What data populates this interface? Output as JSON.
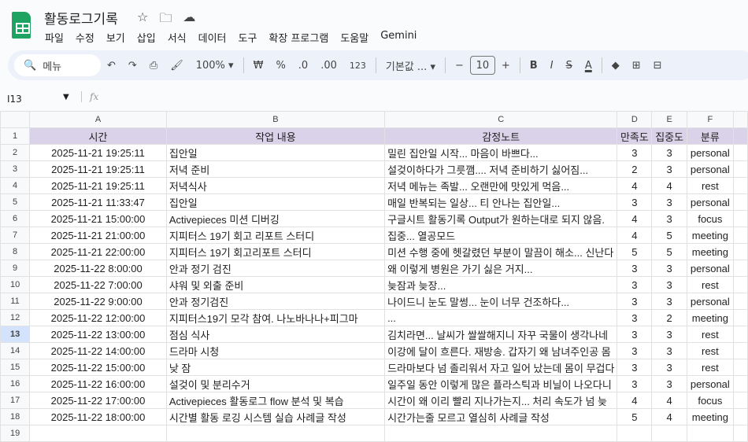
{
  "title": "활동로그기록",
  "menus": [
    "파일",
    "수정",
    "보기",
    "삽입",
    "서식",
    "데이터",
    "도구",
    "확장 프로그램",
    "도움말",
    "Gemini"
  ],
  "toolbar": {
    "search": "메뉴",
    "zoom": "100%",
    "currency": "₩",
    "percent": "%",
    "dec_less": ".0",
    "dec_more": ".00",
    "number_format": "123",
    "font": "기본값 ...",
    "font_size": "10",
    "bold": "B",
    "italic": "I",
    "strike": "S",
    "text_color": "A"
  },
  "name_box": "I13",
  "fx": "fx",
  "columns": [
    "A",
    "B",
    "C",
    "D",
    "E",
    "F"
  ],
  "header": [
    "시간",
    "작업 내용",
    "감정노트",
    "만족도",
    "집중도",
    "분류"
  ],
  "rows": [
    [
      "2025-11-21 19:25:11",
      "집안일",
      "밀린 집안일 시작... 마음이 바쁘다...",
      "3",
      "3",
      "personal"
    ],
    [
      "2025-11-21 19:25:11",
      "저녁 준비",
      "설겆이하다가 그릇깸.... 저녁 준비하기 싫어짐...",
      "2",
      "3",
      "personal"
    ],
    [
      "2025-11-21 19:25:11",
      "저녁식사",
      "저녁 메뉴는 족발... 오랜만에 맛있게 먹음...",
      "4",
      "4",
      "rest"
    ],
    [
      "2025-11-21 11:33:47",
      "집안일",
      "매일 반복되는 일상... 티 안나는 집안일...",
      "3",
      "3",
      "personal"
    ],
    [
      "2025-11-21 15:00:00",
      "Activepieces 미션 디버깅",
      "구글시트 활동기록 Output가 원하는대로 되지 않음.",
      "4",
      "3",
      "focus"
    ],
    [
      "2025-11-21 21:00:00",
      "지피터스 19기 회고 리포트 스터디",
      "집중... 열공모드",
      "4",
      "5",
      "meeting"
    ],
    [
      "2025-11-21 22:00:00",
      "지피터스 19기 회고리포트 스터디",
      "미션 수행 중에 헷갈렸던 부분이 말끔이 해소... 신난다",
      "5",
      "5",
      "meeting"
    ],
    [
      "2025-11-22 8:00:00",
      "안과 정기 검진",
      "왜 이렇게 병원은 가기 싫은 거지...",
      "3",
      "3",
      "personal"
    ],
    [
      "2025-11-22 7:00:00",
      "샤워 및 외출 준비",
      "늦잠과 늦장...",
      "3",
      "3",
      "rest"
    ],
    [
      "2025-11-22 9:00:00",
      "안과 정기검진",
      "나이드니 눈도 말썽... 눈이 너무 건조하다...",
      "3",
      "3",
      "personal"
    ],
    [
      "2025-11-22 12:00:00",
      "지피터스19기 모각 참여. 나노바나나+피그마",
      "...",
      "3",
      "2",
      "meeting"
    ],
    [
      "2025-11-22 13:00:00",
      "점심 식사",
      "김치라면... 날씨가 쌀쌀해지니 자꾸 국물이 생각나네",
      "3",
      "3",
      "rest"
    ],
    [
      "2025-11-22 14:00:00",
      "드라마 시청",
      "이강에 달이 흐른다. 재방송. 갑자기 왜 남녀주인공 몸",
      "3",
      "3",
      "rest"
    ],
    [
      "2025-11-22 15:00:00",
      "낮 잠",
      "드라마보다 넘 졸리워서 자고 일어 났는데 몸이 무겁다",
      "3",
      "3",
      "rest"
    ],
    [
      "2025-11-22 16:00:00",
      "설겆이 및 분리수거",
      "일주일 동안 이렇게 많은 플라스틱과 비닐이 나오다니",
      "3",
      "3",
      "personal"
    ],
    [
      "2025-11-22 17:00:00",
      "Activepieces  활동로그 flow 분석 및 복습",
      "시간이 왜 이리 빨리 지나가는지... 처리 속도가 넘 늦",
      "4",
      "4",
      "focus"
    ],
    [
      "2025-11-22 18:00:00",
      "시간별 활동 로깅 시스템 실습 사례글 작성",
      "시간가는줄 모르고 열심히 사례글 작성",
      "5",
      "4",
      "meeting"
    ]
  ],
  "selected_row": 13
}
